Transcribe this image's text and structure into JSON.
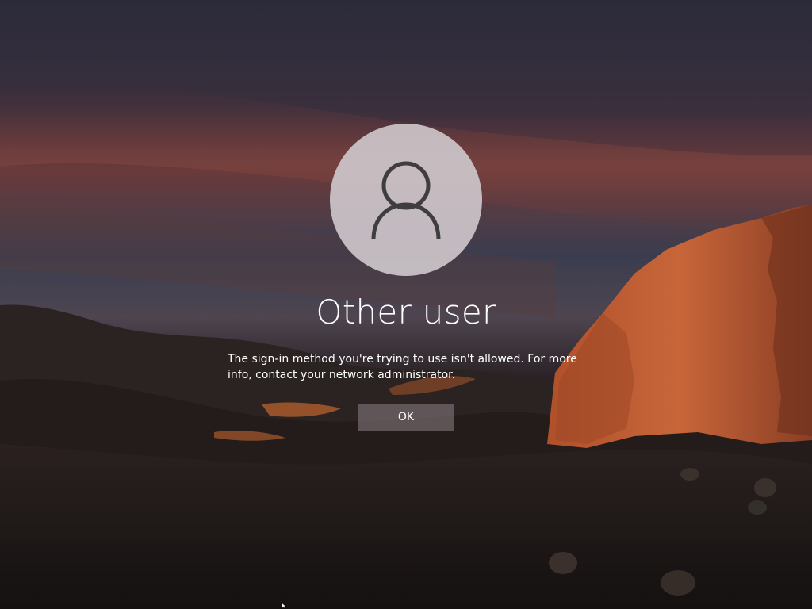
{
  "login": {
    "username": "Other user",
    "message": "The sign-in method you're trying to use isn't allowed. For more info, contact your network administrator.",
    "ok_label": "OK"
  },
  "icons": {
    "avatar": "user-silhouette-icon",
    "cursor": "mouse-pointer-icon"
  },
  "colors": {
    "text": "#ffffff",
    "avatar_bg": "#cdc6ca",
    "avatar_glyph": "#3f3d40",
    "button_bg": "#8c8287"
  }
}
